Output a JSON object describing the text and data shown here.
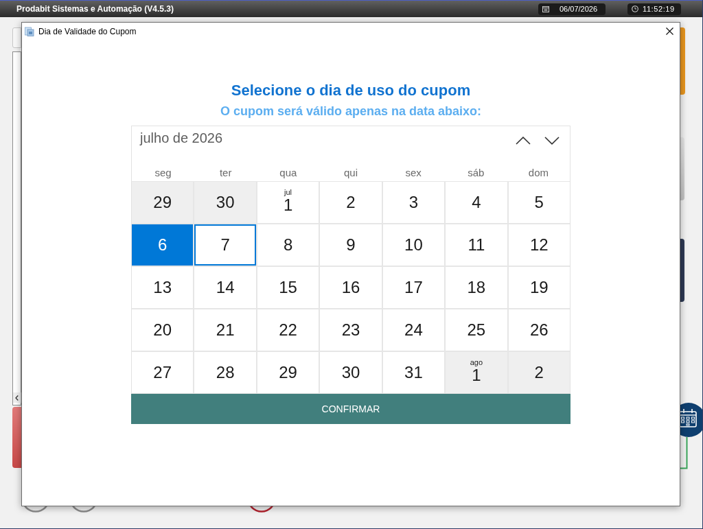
{
  "app_bar": {
    "title": "Prodabit Sistemas e Automação (V4.5.3)",
    "date": "06/07/2026",
    "time": "11:52:19"
  },
  "dialog": {
    "title": "Dia de Validade do Cupom",
    "heading": "Selecione o dia de uso do cupom",
    "subheading": "O cupom será válido apenas na data abaixo:",
    "calendar": {
      "month": "julho de 2026",
      "weekdays": [
        "seg",
        "ter",
        "qua",
        "qui",
        "sex",
        "sáb",
        "dom"
      ],
      "days": [
        {
          "day": "29",
          "outside_month": true,
          "today": false,
          "selected": false
        },
        {
          "day": "30",
          "outside_month": true,
          "today": false,
          "selected": false
        },
        {
          "day": "1",
          "month_label": "jul",
          "outside_month": false,
          "today": false,
          "selected": false
        },
        {
          "day": "2",
          "outside_month": false,
          "today": false,
          "selected": false
        },
        {
          "day": "3",
          "outside_month": false,
          "today": false,
          "selected": false
        },
        {
          "day": "4",
          "outside_month": false,
          "today": false,
          "selected": false
        },
        {
          "day": "5",
          "outside_month": false,
          "today": false,
          "selected": false
        },
        {
          "day": "6",
          "outside_month": false,
          "today": true,
          "selected": false
        },
        {
          "day": "7",
          "outside_month": false,
          "today": false,
          "selected": true
        },
        {
          "day": "8",
          "outside_month": false,
          "today": false,
          "selected": false
        },
        {
          "day": "9",
          "outside_month": false,
          "today": false,
          "selected": false
        },
        {
          "day": "10",
          "outside_month": false,
          "today": false,
          "selected": false
        },
        {
          "day": "11",
          "outside_month": false,
          "today": false,
          "selected": false
        },
        {
          "day": "12",
          "outside_month": false,
          "today": false,
          "selected": false
        },
        {
          "day": "13",
          "outside_month": false,
          "today": false,
          "selected": false
        },
        {
          "day": "14",
          "outside_month": false,
          "today": false,
          "selected": false
        },
        {
          "day": "15",
          "outside_month": false,
          "today": false,
          "selected": false
        },
        {
          "day": "16",
          "outside_month": false,
          "today": false,
          "selected": false
        },
        {
          "day": "17",
          "outside_month": false,
          "today": false,
          "selected": false
        },
        {
          "day": "18",
          "outside_month": false,
          "today": false,
          "selected": false
        },
        {
          "day": "19",
          "outside_month": false,
          "today": false,
          "selected": false
        },
        {
          "day": "20",
          "outside_month": false,
          "today": false,
          "selected": false
        },
        {
          "day": "21",
          "outside_month": false,
          "today": false,
          "selected": false
        },
        {
          "day": "22",
          "outside_month": false,
          "today": false,
          "selected": false
        },
        {
          "day": "23",
          "outside_month": false,
          "today": false,
          "selected": false
        },
        {
          "day": "24",
          "outside_month": false,
          "today": false,
          "selected": false
        },
        {
          "day": "25",
          "outside_month": false,
          "today": false,
          "selected": false
        },
        {
          "day": "26",
          "outside_month": false,
          "today": false,
          "selected": false
        },
        {
          "day": "27",
          "outside_month": false,
          "today": false,
          "selected": false
        },
        {
          "day": "28",
          "outside_month": false,
          "today": false,
          "selected": false
        },
        {
          "day": "29",
          "outside_month": false,
          "today": false,
          "selected": false
        },
        {
          "day": "30",
          "outside_month": false,
          "today": false,
          "selected": false
        },
        {
          "day": "31",
          "outside_month": false,
          "today": false,
          "selected": false
        },
        {
          "day": "1",
          "month_label": "ago",
          "outside_month": true,
          "today": false,
          "selected": false
        },
        {
          "day": "2",
          "outside_month": true,
          "today": false,
          "selected": false
        }
      ]
    },
    "confirm_button": "CONFIRMAR"
  }
}
